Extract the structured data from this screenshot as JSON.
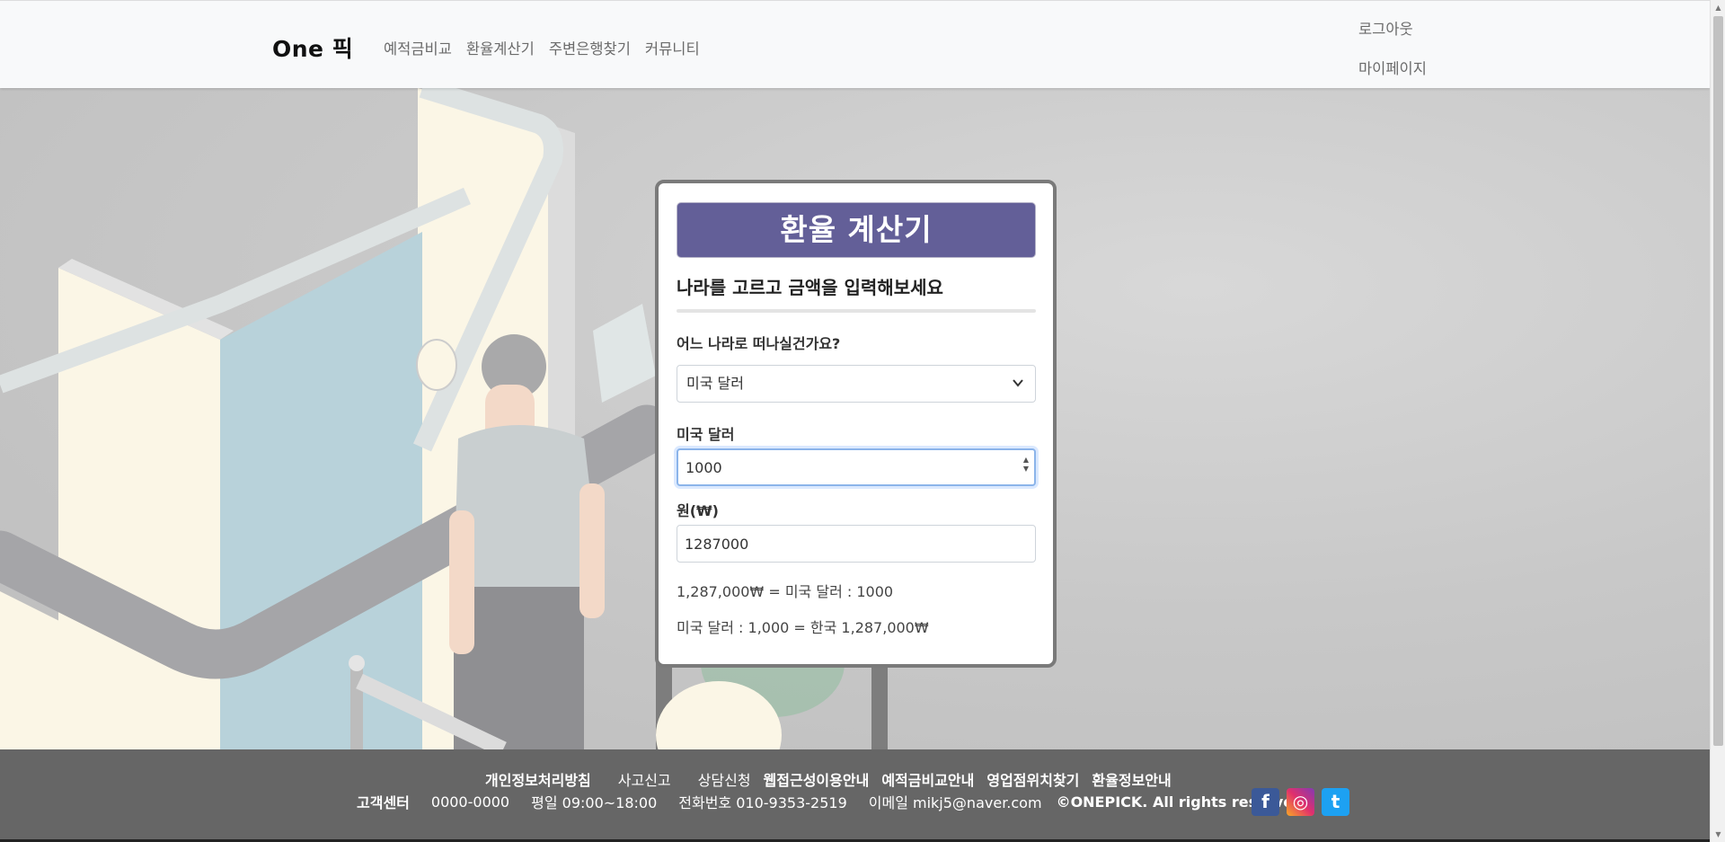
{
  "header": {
    "brand": "One 픽",
    "nav": [
      "예적금비교",
      "환율계산기",
      "주변은행찾기",
      "커뮤니티"
    ],
    "logout": "로그아웃",
    "mypage": "마이페이지"
  },
  "calculator": {
    "title": "환율 계산기",
    "subtitle": "나라를 고르고 금액을 입력해보세요",
    "country_question": "어느 나라로 떠나실건가요?",
    "selected_country": "미국 달러",
    "foreign_label": "미국 달러",
    "foreign_value": "1000",
    "krw_label": "원(₩)",
    "krw_value": "1287000",
    "result_line1": "1,287,000₩ = 미국 달러 : 1000",
    "result_line2": "미국 달러 : 1,000 = 한국 1,287,000₩"
  },
  "footer": {
    "links": [
      "개인정보처리방침",
      "사고신고",
      "상담신청",
      "웹접근성이용안내",
      "예적금비교안내",
      "영업점위치찾기",
      "환율정보안내"
    ],
    "customer_center": "고객센터",
    "phone": "0000-0000",
    "hours": "평일 09:00~18:00",
    "tel": "전화번호 010-9353-2519",
    "email": "이메일 mikj5@naver.com",
    "copyright": "©ONEPICK. All rights reserved.",
    "social": {
      "facebook": "f",
      "instagram": "◎",
      "twitter": "t"
    }
  },
  "colors": {
    "accent": "#635f98",
    "footer_bg": "#666666"
  }
}
